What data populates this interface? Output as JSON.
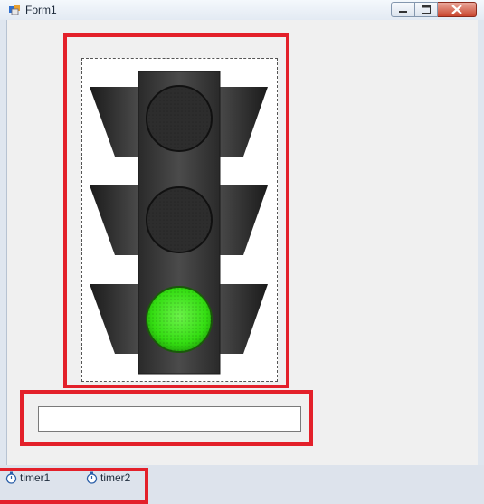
{
  "window": {
    "title": "Form1",
    "buttons": [
      "minimize",
      "maximize",
      "close"
    ]
  },
  "traffic_light": {
    "lamps": [
      "red-off",
      "yellow-off",
      "green-on"
    ],
    "active_color": "#33dd11",
    "off_color": "#2d2d2d",
    "housing_color": "#3a3a3a"
  },
  "textbox": {
    "value": ""
  },
  "components": [
    {
      "label": "timer1",
      "icon": "stopwatch-icon"
    },
    {
      "label": "timer2",
      "icon": "stopwatch-icon"
    }
  ],
  "highlight_color": "#e3202a"
}
